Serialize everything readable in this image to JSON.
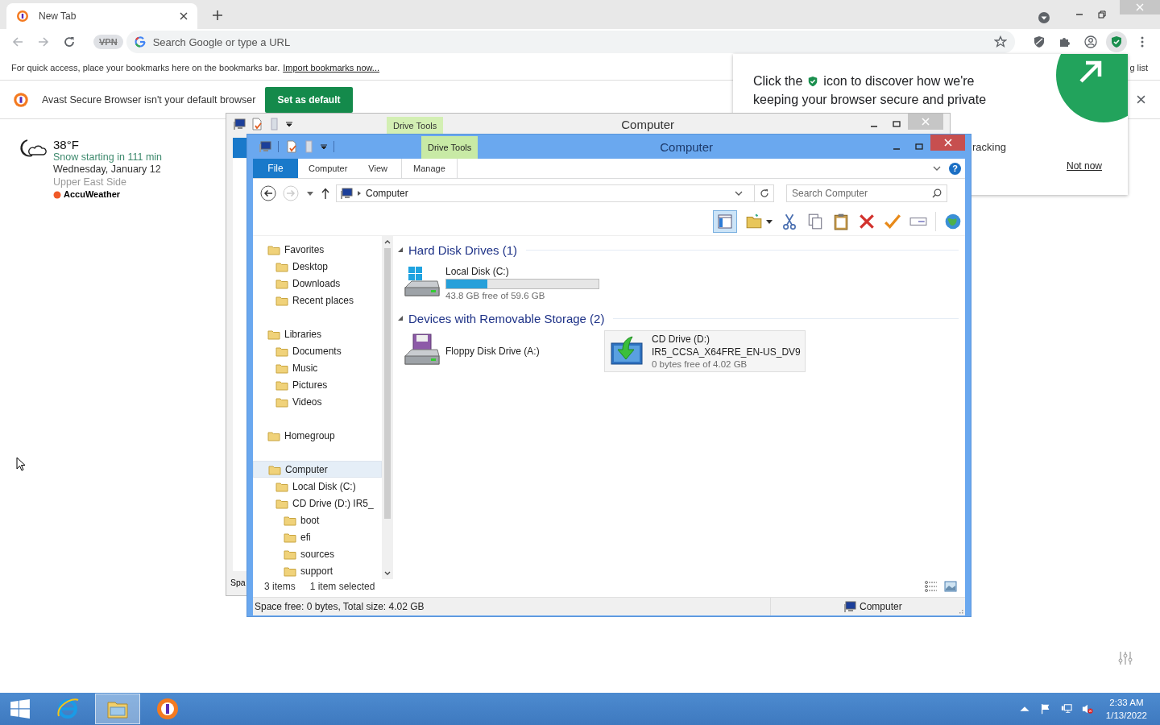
{
  "browser": {
    "tab_title": "New Tab",
    "address": {
      "placeholder": "Search Google or type a URL"
    },
    "vpn": "VPN",
    "bookmarks_bar": {
      "hint": "For quick access, place your bookmarks here on the bookmarks bar.",
      "link": "Import bookmarks now...",
      "reading_list": "g list"
    },
    "infobar": {
      "message": "Avast Secure Browser isn't your default browser",
      "button": "Set as default"
    }
  },
  "weather": {
    "temp": "38°F",
    "forecast": "Snow starting in 111 min",
    "date": "Wednesday, January 12",
    "place": "Upper East Side",
    "source": "AccuWeather"
  },
  "popup": {
    "line_start": "Click the",
    "line_end": "icon to discover how we're",
    "line_2": "keeping your browser secure and private",
    "partial": "racking",
    "dismiss": "Not now"
  },
  "back_window": {
    "title": "Computer",
    "context_tab": "Drive Tools",
    "details": "Spa"
  },
  "explorer": {
    "title": "Computer",
    "context_tab": "Drive Tools",
    "file_tab": "File",
    "tabs": [
      {
        "label": "Computer",
        "contextual": false
      },
      {
        "label": "View",
        "contextual": false
      },
      {
        "label": "Manage",
        "contextual": true
      }
    ],
    "help": "?",
    "address": "Computer",
    "search": {
      "placeholder": "Search Computer"
    },
    "nav": [
      {
        "label": "Favorites",
        "selected": false,
        "children": [
          {
            "label": "Desktop",
            "selected": false
          },
          {
            "label": "Downloads",
            "selected": false
          },
          {
            "label": "Recent places",
            "selected": false
          }
        ]
      },
      {
        "label": "Libraries",
        "selected": false,
        "children": [
          {
            "label": "Documents",
            "selected": false
          },
          {
            "label": "Music",
            "selected": false
          },
          {
            "label": "Pictures",
            "selected": false
          },
          {
            "label": "Videos",
            "selected": false
          }
        ]
      },
      {
        "label": "Homegroup",
        "selected": false
      },
      {
        "label": "Computer",
        "selected": true,
        "children": [
          {
            "label": "Local Disk (C:)",
            "selected": false
          },
          {
            "label": "CD Drive (D:) IR5_",
            "selected": false,
            "children": [
              {
                "label": "boot",
                "selected": false
              },
              {
                "label": "efi",
                "selected": false
              },
              {
                "label": "sources",
                "selected": false
              },
              {
                "label": "support",
                "selected": false
              }
            ]
          }
        ]
      }
    ],
    "sections": [
      {
        "title": "Hard Disk Drives (1)",
        "drives": [
          {
            "kind": "disk",
            "name": "Local Disk (C:)",
            "level": 0.27,
            "free": "43.8 GB free of 59.6 GB",
            "selected": false
          }
        ]
      },
      {
        "title": "Devices with Removable Storage (2)",
        "drives": [
          {
            "kind": "floppy",
            "name": "Floppy Disk Drive (A:)",
            "selected": false
          },
          {
            "kind": "cd",
            "name": "CD Drive (D:)",
            "label": "IR5_CCSA_X64FRE_EN-US_DV9",
            "free": "0 bytes free of 4.02 GB",
            "selected": true
          }
        ]
      }
    ],
    "item_count": "3 items",
    "selection": "1 item selected",
    "details": "Space free: 0 bytes, Total size: 4.02 GB",
    "location": "Computer"
  },
  "taskbar": {
    "apps": [
      {
        "kind": "ie",
        "selected": false
      },
      {
        "kind": "explorer",
        "selected": true
      },
      {
        "kind": "avast",
        "selected": false
      }
    ],
    "clock": {
      "time": "2:33 AM",
      "date": "1/13/2022"
    }
  }
}
